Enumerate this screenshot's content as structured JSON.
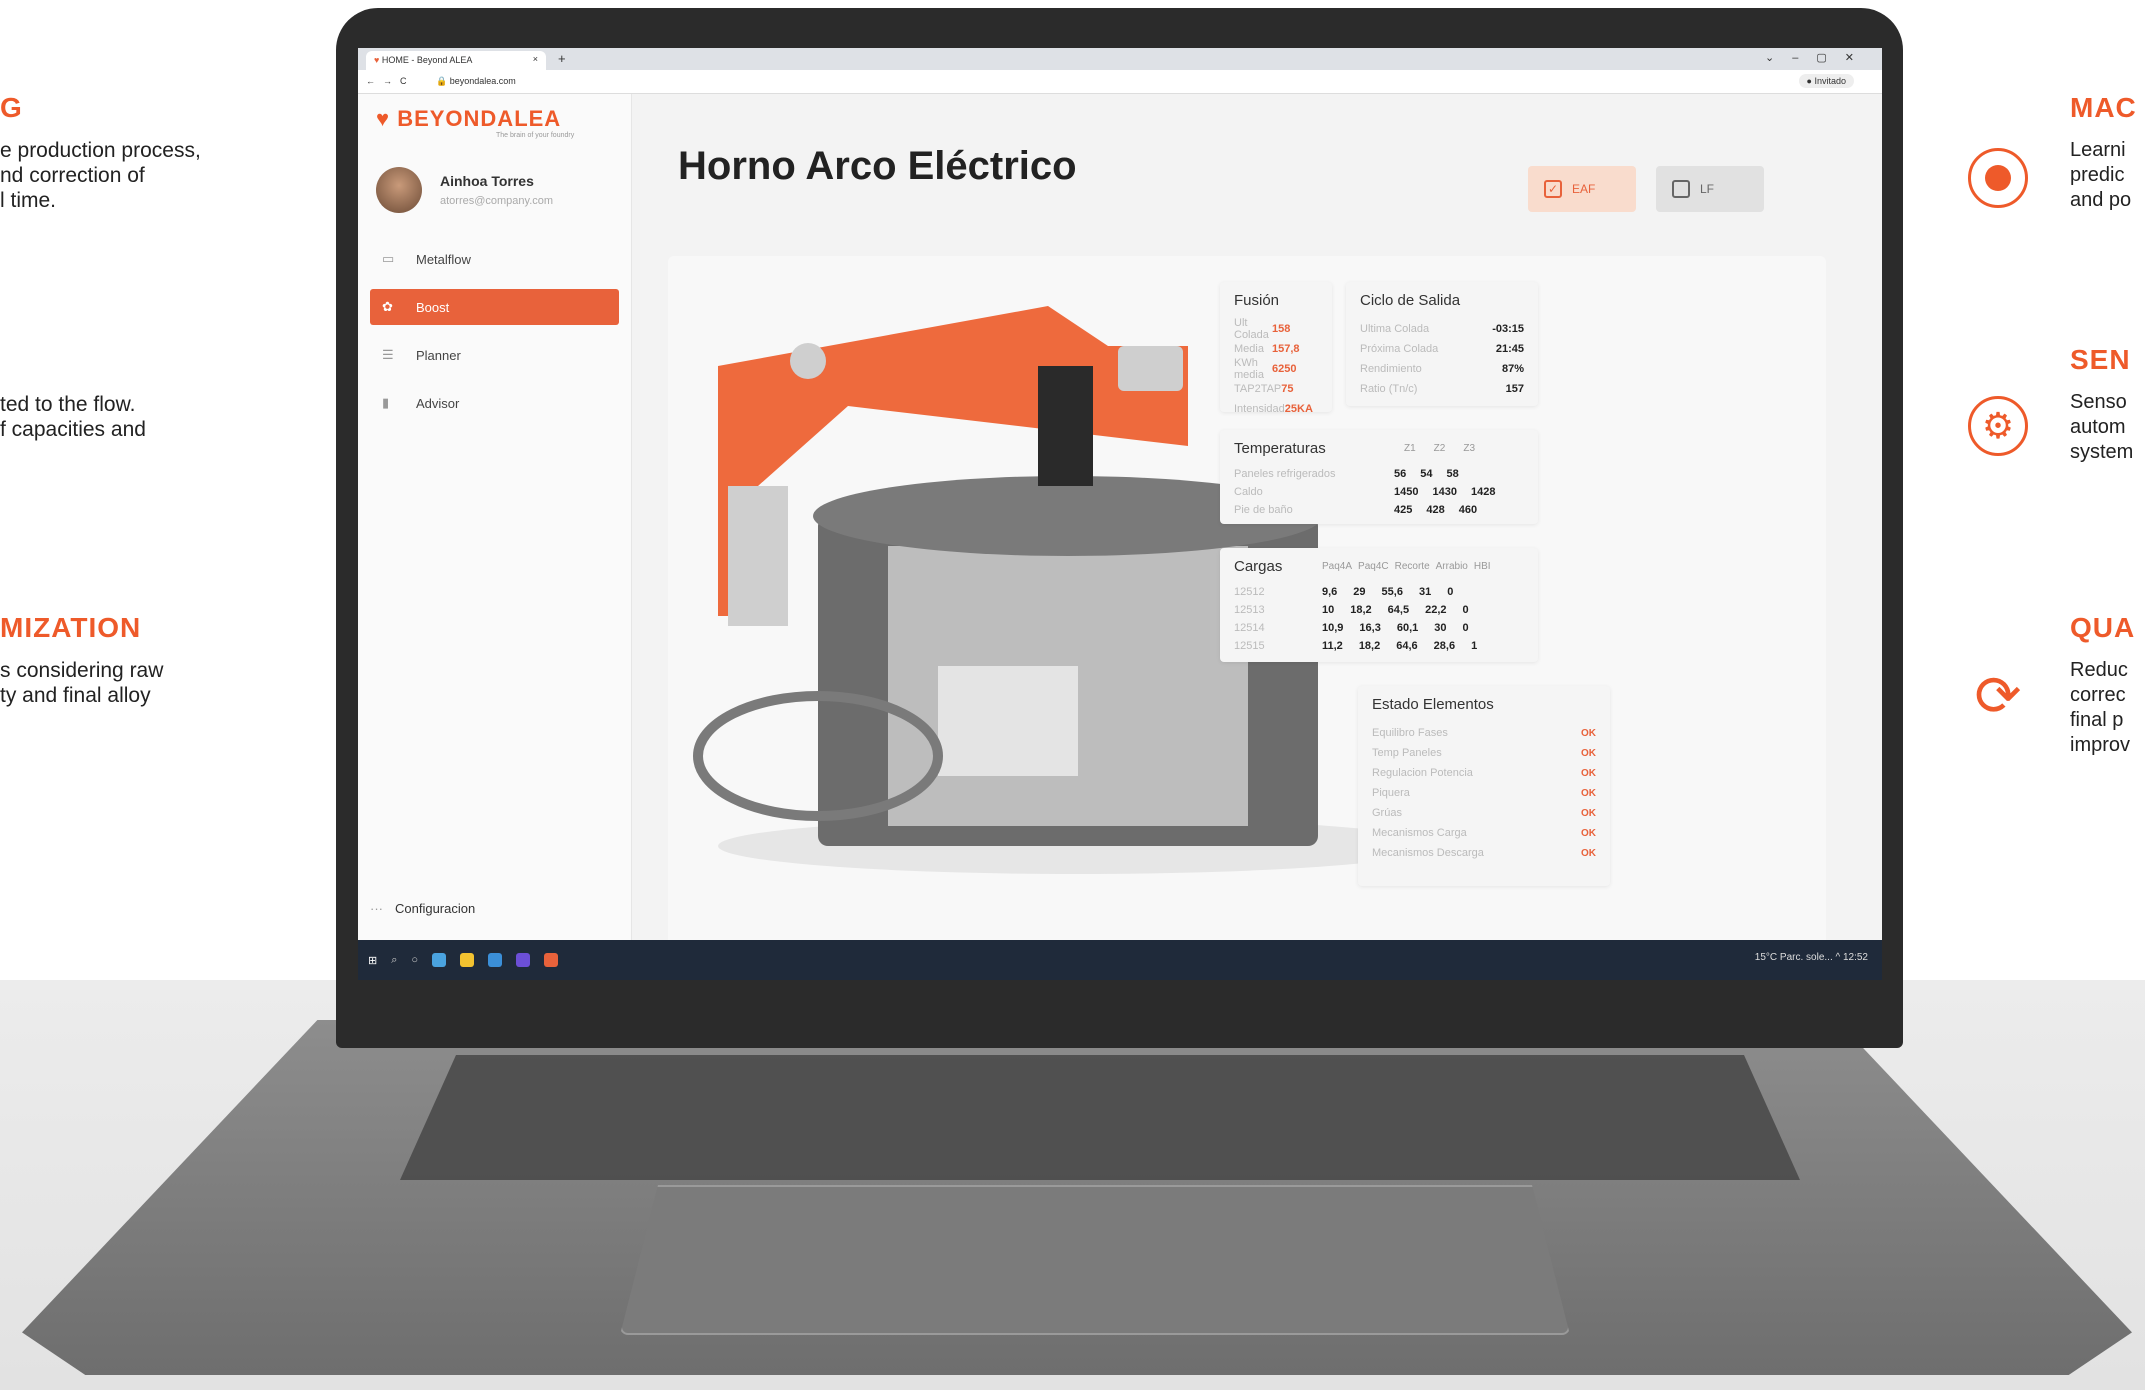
{
  "side_left": [
    {
      "title": "G",
      "body": "e production process,\nnd correction of\nl time."
    },
    {
      "title": "",
      "body": "ted to the flow.\nf capacities and"
    },
    {
      "title": "MIZATION",
      "body": "s considering raw\nty and final alloy"
    }
  ],
  "side_right": [
    {
      "title": "MAC",
      "body": "Learni\npredic\nand po",
      "icon": "ml-icon"
    },
    {
      "title": "SEN",
      "body": "Senso\nautom\nsystem",
      "icon": "gear-icon"
    },
    {
      "title": "QUA",
      "body": "Reduc\ncorrec\nfinal p\nimprov",
      "icon": "cycle-icon"
    }
  ],
  "browser": {
    "tab_title": "HOME - Beyond ALEA",
    "tab_close": "×",
    "new_tab": "+",
    "url": "beyondalea.com",
    "guest_label": "Invitado"
  },
  "app": {
    "brand": "BEYONDALEA",
    "tagline": "The brain of your foundry",
    "user_name": "Ainhoa Torres",
    "user_email": "atorres@company.com",
    "menu": [
      {
        "label": "Metalflow",
        "icon": "monitor-icon",
        "glyph": "▭"
      },
      {
        "label": "Boost",
        "icon": "boost-icon",
        "glyph": "✿"
      },
      {
        "label": "Planner",
        "icon": "list-icon",
        "glyph": "☰"
      },
      {
        "label": "Advisor",
        "icon": "bars-icon",
        "glyph": "▮"
      }
    ],
    "config_label": "Configuracion",
    "page_title": "Horno Arco Eléctrico",
    "toggle_eaf": "EAF",
    "toggle_lf": "LF"
  },
  "fusion": {
    "title": "Fusión",
    "rows": [
      {
        "label": "Ult Colada",
        "value": "158"
      },
      {
        "label": "Media",
        "value": "157,8"
      },
      {
        "label": "KWh media",
        "value": "6250"
      },
      {
        "label": "TAP2TAP",
        "value": "75"
      },
      {
        "label": "Intensidad",
        "value": "25KA"
      }
    ]
  },
  "ciclo": {
    "title": "Ciclo de Salida",
    "rows": [
      {
        "label": "Ultima Colada",
        "value": "-03:15"
      },
      {
        "label": "Próxima Colada",
        "value": "21:45"
      },
      {
        "label": "Rendimiento",
        "value": "87%"
      },
      {
        "label": "Ratio (Tn/c)",
        "value": "157"
      }
    ]
  },
  "temperaturas": {
    "title": "Temperaturas",
    "headers": [
      "Z1",
      "Z2",
      "Z3"
    ],
    "rows": [
      {
        "label": "Paneles refrigerados",
        "v": [
          "56",
          "54",
          "58"
        ]
      },
      {
        "label": "Caldo",
        "v": [
          "1450",
          "1430",
          "1428"
        ]
      },
      {
        "label": "Pie de baño",
        "v": [
          "425",
          "428",
          "460"
        ]
      }
    ]
  },
  "cargas": {
    "title": "Cargas",
    "headers": [
      "Paq4A",
      "Paq4C",
      "Recorte",
      "Arrabio",
      "HBI"
    ],
    "rows": [
      {
        "id": "12512",
        "v": [
          "9,6",
          "29",
          "55,6",
          "31",
          "0"
        ]
      },
      {
        "id": "12513",
        "v": [
          "10",
          "18,2",
          "64,5",
          "22,2",
          "0"
        ]
      },
      {
        "id": "12514",
        "v": [
          "10,9",
          "16,3",
          "60,1",
          "30",
          "0"
        ]
      },
      {
        "id": "12515",
        "v": [
          "11,2",
          "18,2",
          "64,6",
          "28,6",
          "1"
        ]
      }
    ]
  },
  "estado": {
    "title": "Estado Elementos",
    "rows": [
      {
        "label": "Equilibro Fases",
        "value": "OK"
      },
      {
        "label": "Temp Paneles",
        "value": "OK"
      },
      {
        "label": "Regulacion Potencia",
        "value": "OK"
      },
      {
        "label": "Piquera",
        "value": "OK"
      },
      {
        "label": "Grúas",
        "value": "OK"
      },
      {
        "label": "Mecanismos Carga",
        "value": "OK"
      },
      {
        "label": "Mecanismos Descarga",
        "value": "OK"
      }
    ]
  },
  "taskbar": {
    "tray": "15°C Parc. sole...  ^  12:52"
  },
  "colors": {
    "accent": "#e8623b",
    "title_orange": "#ee5a2a"
  }
}
